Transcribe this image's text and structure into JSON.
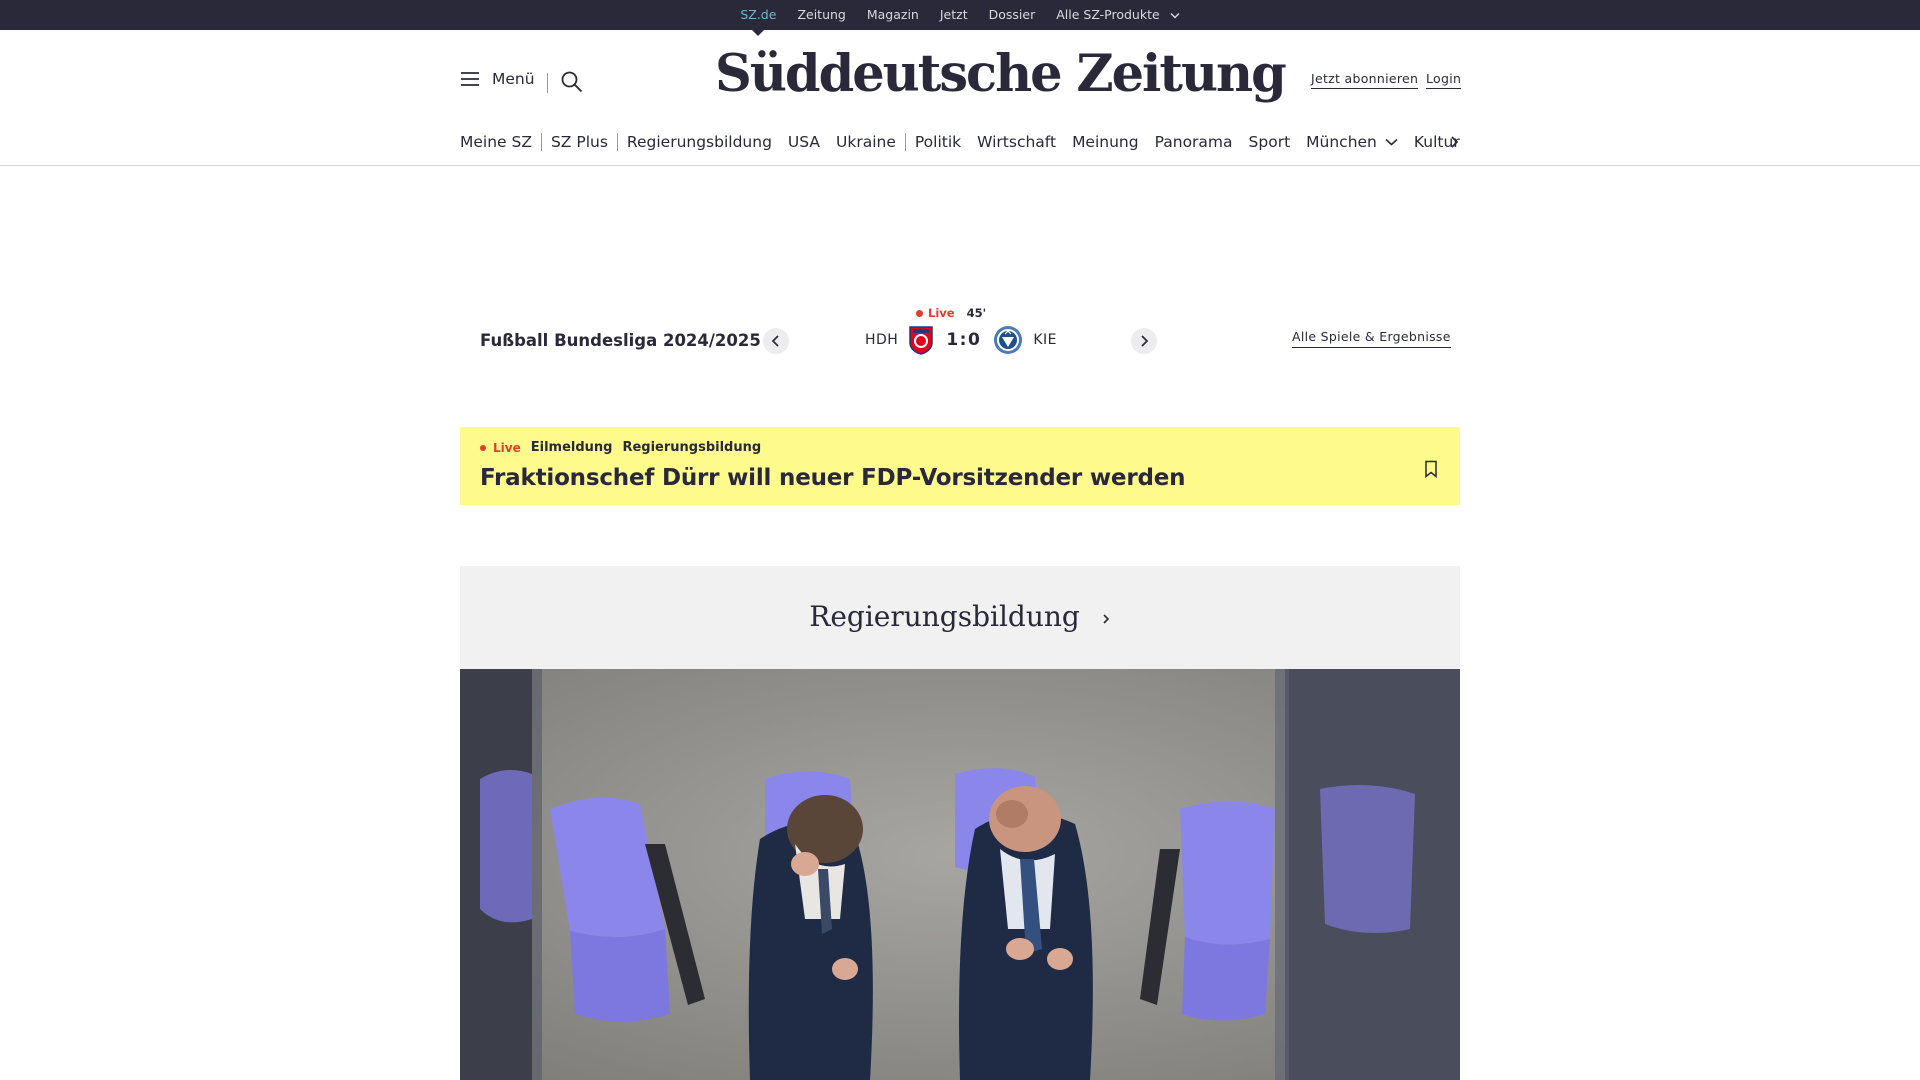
{
  "topbar": {
    "links": [
      "SZ.de",
      "Zeitung",
      "Magazin",
      "Jetzt",
      "Dossier",
      "Alle SZ-Produkte"
    ]
  },
  "header": {
    "menu_label": "Menü",
    "logo": "Süddeutsche Zeitung",
    "subscribe": "Jetzt abonnieren",
    "login": "Login"
  },
  "nav": {
    "items": [
      "Meine SZ",
      "SZ Plus",
      "Regierungsbildung",
      "USA",
      "Ukraine",
      "Politik",
      "Wirtschaft",
      "Meinung",
      "Panorama",
      "Sport",
      "München",
      "Kultur"
    ]
  },
  "scoreboard": {
    "league": "Fußball Bundesliga 2024/2025",
    "live": "Live",
    "minute": "45'",
    "home": "HDH",
    "away": "KIE",
    "score": "1:0",
    "all_games": "Alle Spiele & Ergebnisse",
    "home_color": "#e2001a",
    "away_color": "#4a7ab8"
  },
  "breaking": {
    "live": "Live",
    "kind": "Eilmeldung",
    "topic": "Regierungsbildung",
    "title": "Fraktionschef Dürr will neuer FDP-Vorsitzender werden",
    "background": "#fefa8c"
  },
  "dossier": {
    "title": "Regierungsbildung"
  },
  "colors": {
    "ink": "#29293a",
    "accent": "#71b7c9",
    "live": "#e53b2d"
  }
}
